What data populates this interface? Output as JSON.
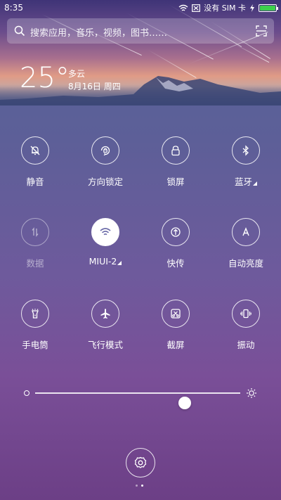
{
  "status_bar": {
    "time": "8:35",
    "no_sim": "没有 SIM 卡",
    "battery_level": 1.0
  },
  "search": {
    "placeholder": "搜索应用，音乐，视频，图书……"
  },
  "weather": {
    "temperature": "25°",
    "condition": "多云",
    "date": "8月16日 周四"
  },
  "tiles": [
    {
      "label": "静音",
      "icon": "mute-bell-icon",
      "state": "normal"
    },
    {
      "label": "方向锁定",
      "icon": "rotation-lock-icon",
      "state": "normal"
    },
    {
      "label": "锁屏",
      "icon": "lock-screen-icon",
      "state": "normal"
    },
    {
      "label": "蓝牙",
      "icon": "bluetooth-icon",
      "state": "normal",
      "has_menu": true
    },
    {
      "label": "数据",
      "icon": "mobile-data-icon",
      "state": "disabled"
    },
    {
      "label": "MIUI-2",
      "icon": "wifi-icon",
      "state": "on",
      "has_menu": true
    },
    {
      "label": "快传",
      "icon": "quick-transfer-icon",
      "state": "normal"
    },
    {
      "label": "自动亮度",
      "icon": "auto-brightness-icon",
      "state": "normal"
    },
    {
      "label": "手电筒",
      "icon": "flashlight-icon",
      "state": "normal"
    },
    {
      "label": "飞行模式",
      "icon": "airplane-icon",
      "state": "normal"
    },
    {
      "label": "截屏",
      "icon": "screenshot-icon",
      "state": "normal"
    },
    {
      "label": "振动",
      "icon": "vibrate-icon",
      "state": "normal"
    }
  ],
  "brightness": {
    "level": 0.73
  },
  "pager": {
    "count": 2,
    "active": 1
  }
}
